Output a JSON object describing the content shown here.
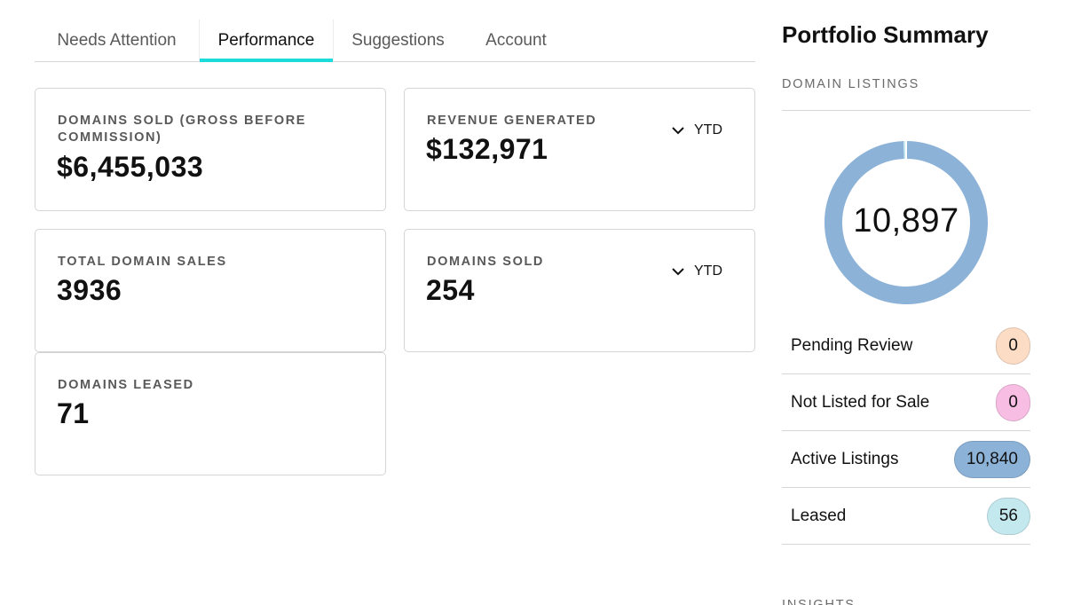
{
  "tabs": [
    {
      "label": "Needs Attention",
      "active": false
    },
    {
      "label": "Performance",
      "active": true
    },
    {
      "label": "Suggestions",
      "active": false
    },
    {
      "label": "Account",
      "active": false
    }
  ],
  "cards": {
    "domains_sold_gross": {
      "label": "DOMAINS SOLD (GROSS BEFORE COMMISSION)",
      "value": "$6,455,033"
    },
    "revenue_generated": {
      "label": "REVENUE GENERATED",
      "value": "$132,971",
      "period": "YTD"
    },
    "total_domain_sales": {
      "label": "TOTAL DOMAIN SALES",
      "value": "3936"
    },
    "domains_sold": {
      "label": "DOMAINS SOLD",
      "value": "254",
      "period": "YTD"
    },
    "domains_leased": {
      "label": "DOMAINS LEASED",
      "value": "71"
    }
  },
  "summary": {
    "title": "Portfolio Summary",
    "listings_label": "DOMAIN LISTINGS",
    "total": "10,897",
    "rows": [
      {
        "label": "Pending Review",
        "count": "0",
        "color": "#fcdcc5"
      },
      {
        "label": "Not Listed for Sale",
        "count": "0",
        "color": "#f7bde3"
      },
      {
        "label": "Active Listings",
        "count": "10,840",
        "color": "#8db2d8"
      },
      {
        "label": "Leased",
        "count": "56",
        "color": "#c3e8ee"
      }
    ],
    "donut_segments": [
      {
        "name": "Pending Review",
        "value": 0,
        "color": "#fcdcc5"
      },
      {
        "name": "Not Listed for Sale",
        "value": 0,
        "color": "#f7bde3"
      },
      {
        "name": "Active Listings",
        "value": 10840,
        "color": "#8db2d8"
      },
      {
        "name": "Leased",
        "value": 56,
        "color": "#c3e8ee"
      }
    ],
    "insights_label": "INSIGHTS"
  },
  "colors": {
    "accent": "#1bdbdb",
    "donut_main": "#8db2d8"
  }
}
